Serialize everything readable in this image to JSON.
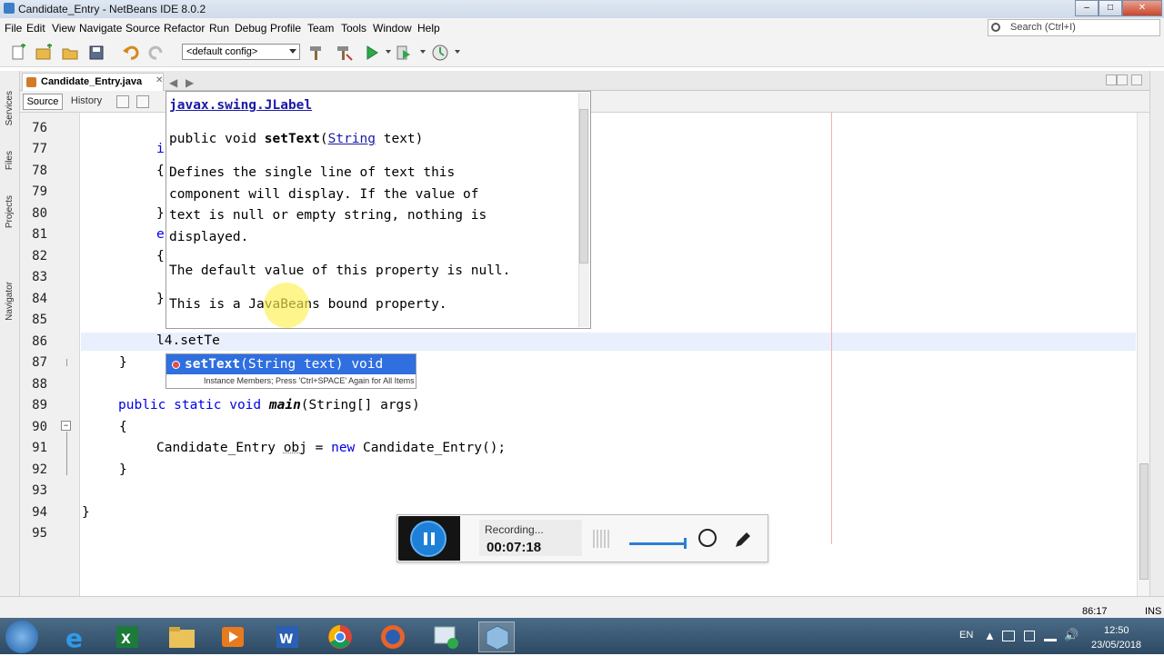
{
  "window": {
    "title": "Candidate_Entry - NetBeans IDE 8.0.2",
    "minimize": "–",
    "maximize": "□",
    "close": "✕"
  },
  "menu": [
    "File",
    "Edit",
    "View",
    "Navigate",
    "Source",
    "Refactor",
    "Run",
    "Debug",
    "Profile",
    "Team",
    "Tools",
    "Window",
    "Help"
  ],
  "search": {
    "placeholder": "Search (Ctrl+I)"
  },
  "toolbar": {
    "config": "<default config>"
  },
  "side_panels": [
    "Services",
    "Files",
    "Projects",
    "Navigator"
  ],
  "editor": {
    "tab": "Candidate_Entry.java",
    "source_label": "Source",
    "history_label": "History",
    "line_numbers": [
      "76",
      "77",
      "78",
      "79",
      "80",
      "81",
      "82",
      "83",
      "84",
      "85",
      "86",
      "87",
      "88",
      "89",
      "90",
      "91",
      "92",
      "93",
      "94",
      "95"
    ],
    "partial": [
      "i",
      "{",
      "}",
      "e",
      "{",
      "}"
    ],
    "current_line": "l4.setTe",
    "line_87": "}",
    "line_89_kw": "public static void ",
    "line_89_name": "main",
    "line_89_rest": "(String[] args)",
    "line_90": "{",
    "line_91_a": "Candidate_Entry ",
    "line_91_b": "obj",
    "line_91_c": " = ",
    "line_91_kw": "new",
    "line_91_d": " Candidate_Entry();",
    "line_92": "}",
    "line_94": "}"
  },
  "javadoc": {
    "class_link": "javax.swing.JLabel",
    "signature_a": "public void ",
    "signature_method": "setText",
    "signature_b": "(",
    "signature_type": "String",
    "signature_c": " text)",
    "desc_1": "Defines the single line of text this",
    "desc_2": "component will display. If the value of",
    "desc_3": "text is null or empty string, nothing is",
    "desc_4": "displayed.",
    "default_line": "The default value of this property is null.",
    "bound_line": "This is a JavaBeans bound property."
  },
  "completion": {
    "method": "setText",
    "params": "(String text) void",
    "hint": "Instance Members; Press 'Ctrl+SPACE' Again for All Items"
  },
  "status": {
    "position": "86:17",
    "mode": "INS"
  },
  "recorder": {
    "status": "Recording...",
    "time": "00:07:18"
  },
  "taskbar": {
    "apps": [
      "start-button",
      "internet-explorer",
      "excel",
      "file-explorer",
      "media-player",
      "word",
      "chrome",
      "firefox",
      "remote-app",
      "netbeans"
    ],
    "language": "EN",
    "time": "12:50",
    "date": "23/05/2018"
  }
}
